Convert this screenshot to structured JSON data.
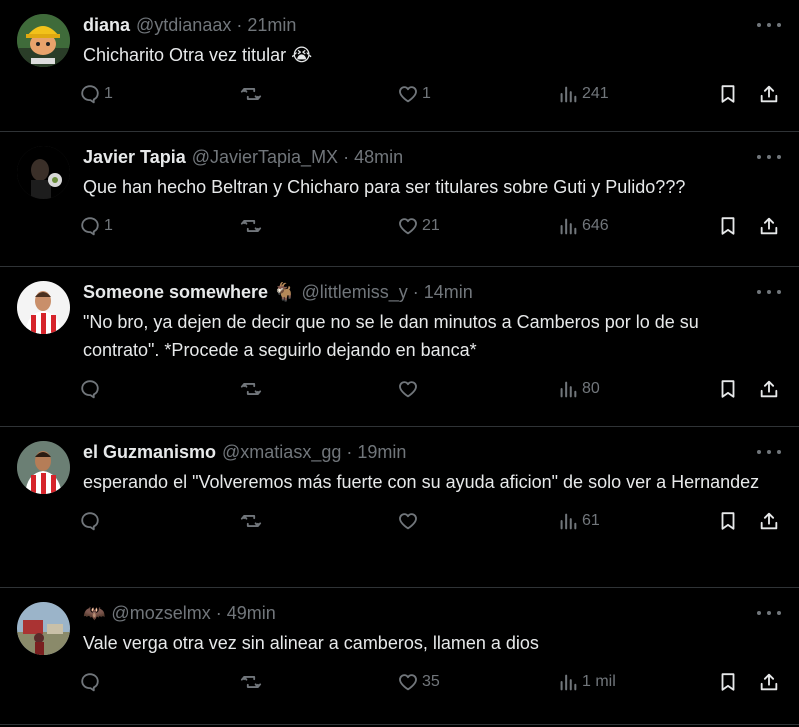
{
  "tweets": [
    {
      "name": "diana",
      "handle": "@ytdianaax",
      "time": "21min",
      "text": "Chicharito Otra vez titular 😭",
      "replies": "1",
      "retweets": "",
      "likes": "1",
      "views": "241",
      "avatar_icon": "cartoon-hardhat-avatar"
    },
    {
      "name": "Javier Tapia",
      "handle": "@JavierTapia_MX",
      "time": "48min",
      "text": "Que han hecho Beltran y Chicharo para ser titulares sobre Guti y Pulido???",
      "replies": "1",
      "retweets": "",
      "likes": "21",
      "views": "646",
      "avatar_icon": "dark-portrait-avatar"
    },
    {
      "name": "Someone somewhere",
      "name_emoji": "🐐",
      "handle": "@littlemiss_y",
      "time": "14min",
      "text": "\"No bro, ya dejen de decir que no se le dan minutos a Camberos por lo de su contrato\". *Procede a seguirlo dejando en banca*",
      "replies": "",
      "retweets": "",
      "likes": "",
      "views": "80",
      "avatar_icon": "player-striped-jersey-avatar"
    },
    {
      "name": "el Guzmanismo",
      "handle": "@xmatiasx_gg",
      "time": "19min",
      "text": "esperando el \"Volveremos más fuerte con su ayuda aficion\" de solo ver a Hernandez",
      "replies": "",
      "retweets": "",
      "likes": "",
      "views": "61",
      "avatar_icon": "player-striped-jersey-avatar"
    },
    {
      "name": "",
      "name_emoji": "🦇",
      "handle": "@mozselmx",
      "time": "49min",
      "text": "Vale verga otra vez sin alinear a camberos, llamen  a dios",
      "replies": "",
      "retweets": "",
      "likes": "35",
      "views": "1 mil",
      "avatar_icon": "outdoor-photo-avatar"
    }
  ],
  "colors": {
    "background": "#000000",
    "text": "#e7e9ea",
    "secondary": "#71767b",
    "divider": "#2f3336",
    "bookmark_share": "#e7e9ea"
  }
}
